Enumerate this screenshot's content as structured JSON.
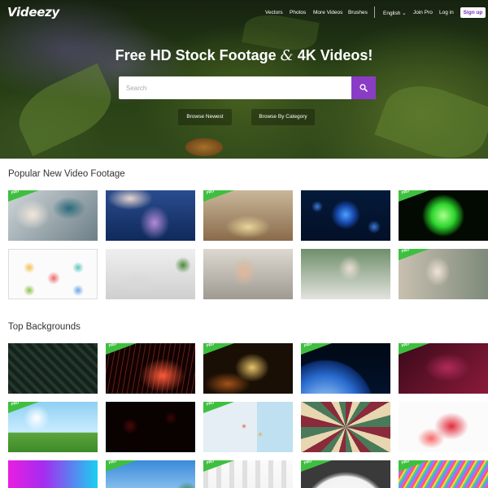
{
  "brand": {
    "logo": "Videezy"
  },
  "nav": {
    "items": [
      "Vectors",
      "Photos",
      "More Videos",
      "Brushes"
    ],
    "language": "English",
    "join_pro": "Join Pro",
    "login": "Log in",
    "signup": "Sign up"
  },
  "hero": {
    "title_part1": "Free HD Stock Footage ",
    "title_amp": "&",
    "title_part2": " 4K Videos!",
    "search_placeholder": "Search",
    "browse_newest": "Browse Newest",
    "browse_category": "Browse By Category"
  },
  "sections": [
    {
      "title": "Popular New Video Footage",
      "thumbs": [
        {
          "desc": "scientist-microscope",
          "pro": true
        },
        {
          "desc": "lab-beaker",
          "pro": false
        },
        {
          "desc": "cafe-interior",
          "pro": true
        },
        {
          "desc": "blue-virus",
          "pro": false
        },
        {
          "desc": "green-virus",
          "pro": true
        },
        {
          "desc": "infographic-people",
          "pro": false
        },
        {
          "desc": "laptop-desk",
          "pro": false
        },
        {
          "desc": "man-couch-phone",
          "pro": false
        },
        {
          "desc": "woman-mask-laptop",
          "pro": false
        },
        {
          "desc": "woman-mask-street",
          "pro": true
        }
      ]
    },
    {
      "title": "Top Backgrounds",
      "thumbs": [
        {
          "desc": "dark-maze",
          "pro": false
        },
        {
          "desc": "red-particles",
          "pro": true
        },
        {
          "desc": "gold-particles",
          "pro": true
        },
        {
          "desc": "earth-space",
          "pro": true
        },
        {
          "desc": "magenta-abstract",
          "pro": true
        },
        {
          "desc": "sunny-field",
          "pro": true
        },
        {
          "desc": "dark-red-bokeh",
          "pro": false
        },
        {
          "desc": "map-pins",
          "pro": true
        },
        {
          "desc": "kaleidoscope",
          "pro": false
        },
        {
          "desc": "red-smoke",
          "pro": false
        },
        {
          "desc": "neon-gradient",
          "pro": false
        },
        {
          "desc": "sky-trees",
          "pro": true
        },
        {
          "desc": "bar-chart",
          "pro": true
        },
        {
          "desc": "clock",
          "pro": true
        },
        {
          "desc": "colorful-lines",
          "pro": true
        }
      ]
    }
  ],
  "pro_label": "PRO",
  "colors": {
    "accent": "#8a3cc6",
    "pro": "#3fbf3f"
  }
}
